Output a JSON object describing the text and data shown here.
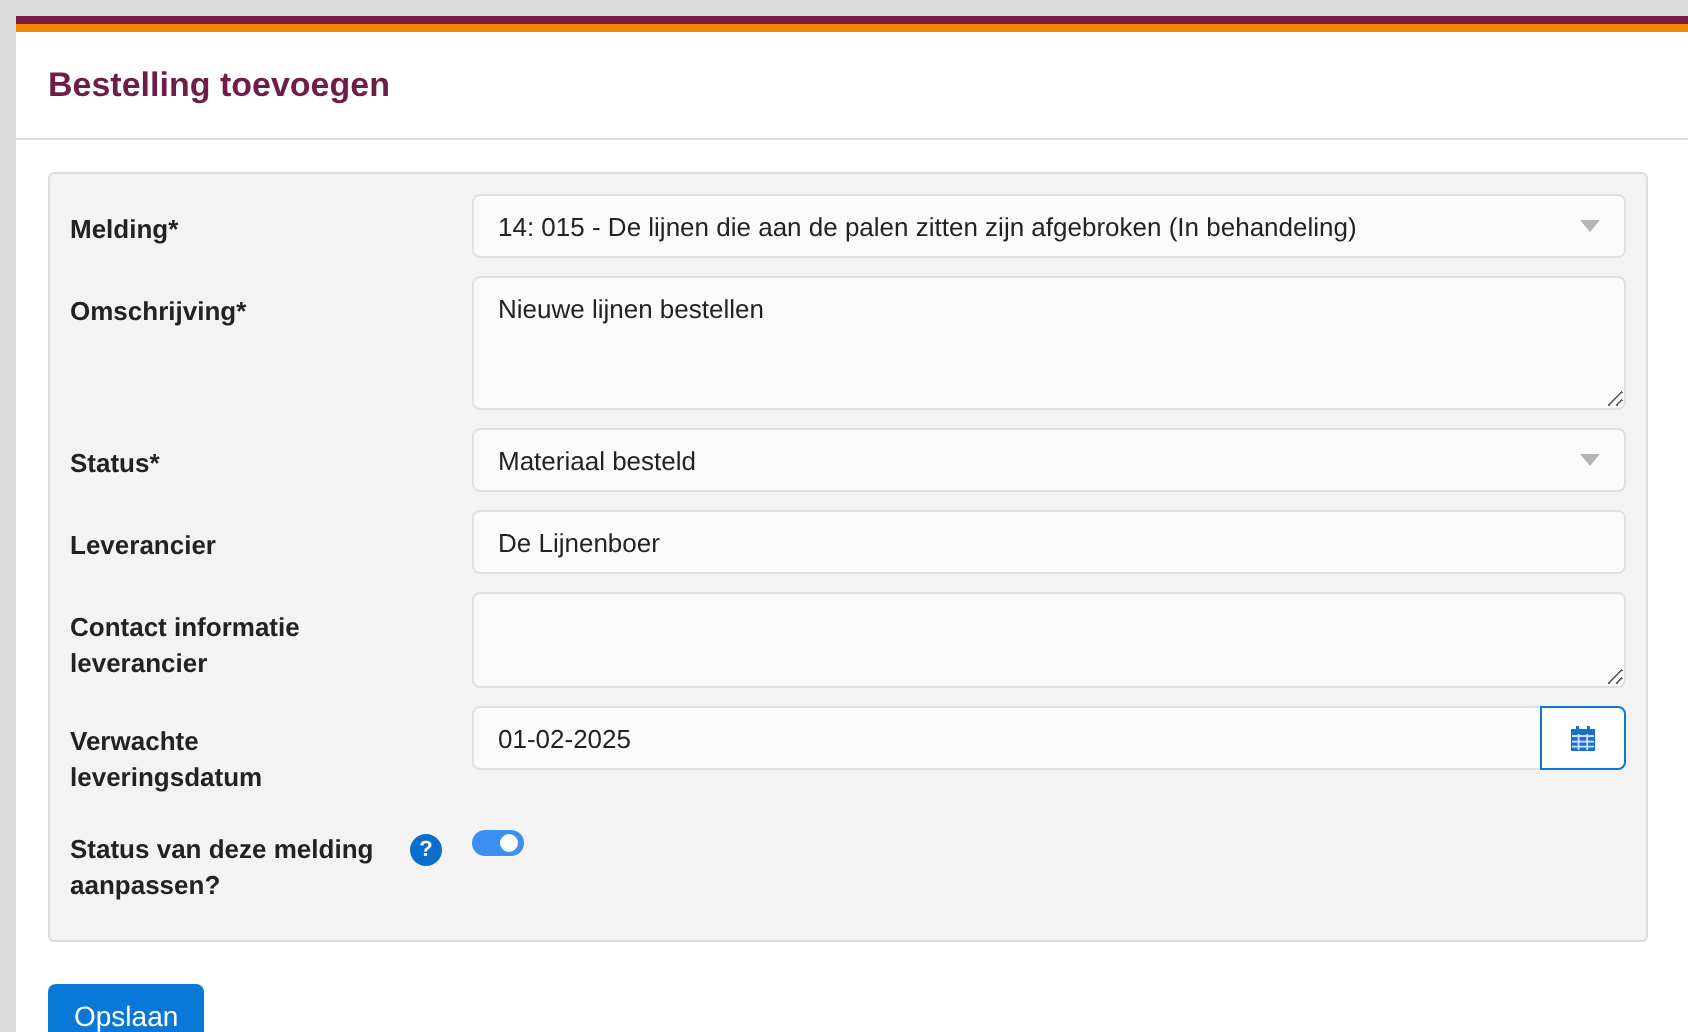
{
  "page": {
    "title": "Bestelling toevoegen"
  },
  "fields": [
    {
      "kind": "select",
      "label": "Melding*",
      "value": "14: 015 - De lijnen die aan de palen zitten zijn afgebroken (In behandeling)"
    },
    {
      "kind": "textarea",
      "label": "Omschrijving*",
      "value": "Nieuwe lijnen bestellen"
    },
    {
      "kind": "select",
      "label": "Status*",
      "value": "Materiaal besteld"
    },
    {
      "kind": "input",
      "label": "Leverancier",
      "value": "De Lijnenboer"
    },
    {
      "kind": "textarea",
      "label": "Contact informatie leverancier"
    },
    {
      "kind": "date",
      "label": "Verwachte leveringsdatum",
      "value": "01-02-2025"
    },
    {
      "kind": "toggle",
      "label": "Status van deze melding aanpassen?",
      "help": "?",
      "on": true
    }
  ],
  "save_button": "Opslaan"
}
